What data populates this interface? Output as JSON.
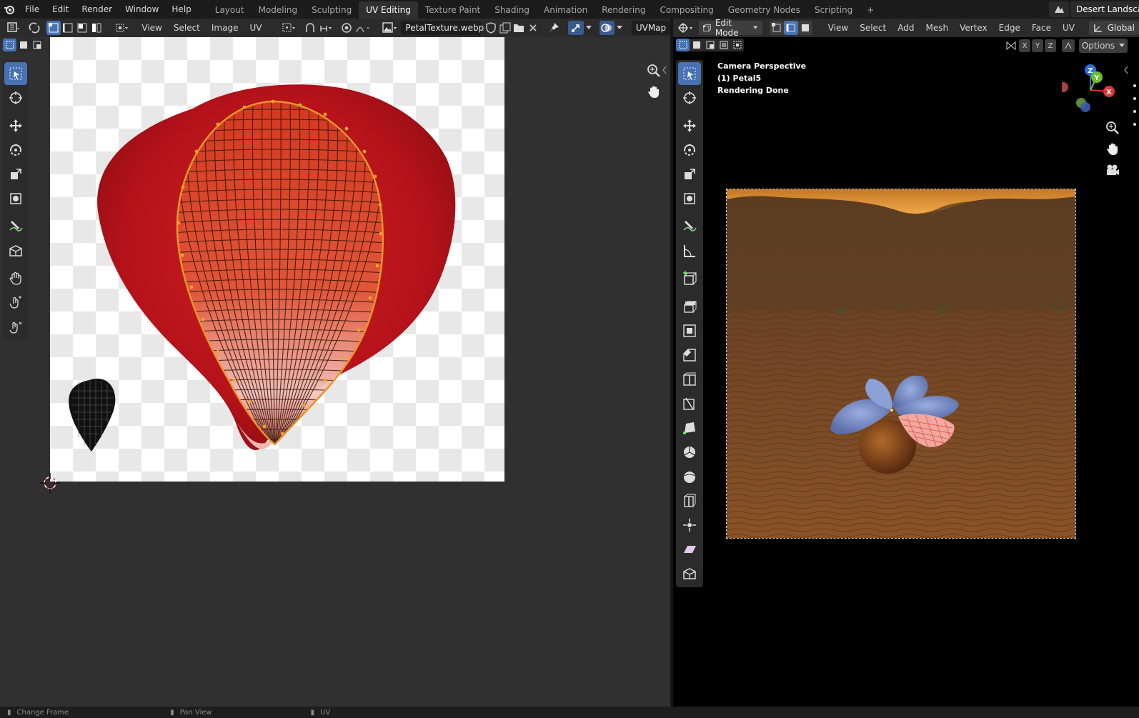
{
  "topbar": {
    "menus": [
      "File",
      "Edit",
      "Render",
      "Window",
      "Help"
    ],
    "workspaces": [
      "Layout",
      "Modeling",
      "Sculpting",
      "UV Editing",
      "Texture Paint",
      "Shading",
      "Animation",
      "Rendering",
      "Compositing",
      "Geometry Nodes",
      "Scripting"
    ],
    "active_workspace": "UV Editing",
    "add_tab": "+",
    "scene_name": "Desert Landscap"
  },
  "uv_editor": {
    "menus": [
      "View",
      "Select",
      "Image",
      "UV"
    ],
    "image_name": "PetalTexture.webp",
    "uv_map": "UVMap"
  },
  "viewport": {
    "mode": "Edit Mode",
    "menus": [
      "View",
      "Select",
      "Add",
      "Mesh",
      "Vertex",
      "Edge",
      "Face",
      "UV"
    ],
    "orientation": "Global",
    "axes": [
      "X",
      "Y",
      "Z"
    ],
    "options_label": "Options",
    "info_line1": "Camera Perspective",
    "info_line2": "(1) Petal5",
    "info_line3": "Rendering Done",
    "gizmo_x": "X",
    "gizmo_y": "Y",
    "gizmo_z": "Z"
  },
  "statusbar": {
    "item1": "Change Frame",
    "item2": "Pan View",
    "item3": "UV"
  },
  "colors": {
    "accent": "#4772b3",
    "uv_edge": "#e8952c",
    "petal": "#c0141c"
  }
}
